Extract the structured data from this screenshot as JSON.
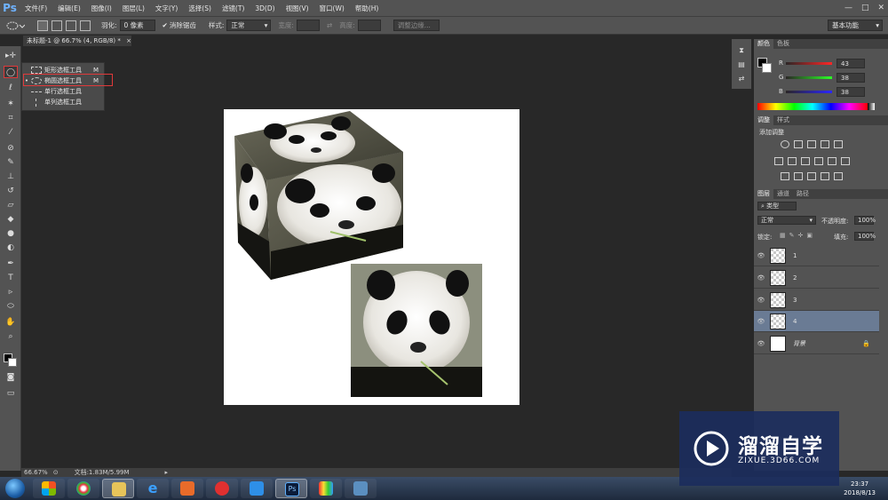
{
  "app": {
    "logo": "Ps",
    "menu": [
      "文件(F)",
      "编辑(E)",
      "图像(I)",
      "图层(L)",
      "文字(Y)",
      "选择(S)",
      "滤镜(T)",
      "3D(D)",
      "视图(V)",
      "窗口(W)",
      "帮助(H)"
    ],
    "window_controls": [
      "—",
      "□",
      "✕"
    ]
  },
  "options": {
    "feather_label": "羽化:",
    "feather_value": "0 像素",
    "antialias_label": "消除锯齿",
    "style_label": "样式:",
    "style_value": "正常",
    "width_label": "宽度:",
    "height_label": "高度:",
    "refine_edge": "调整边缘...",
    "workspace": "基本功能"
  },
  "document": {
    "tab_title": "未标题-1 @ 66.7% (4, RGB/8) *",
    "close": "×"
  },
  "flyout": {
    "items": [
      {
        "label": "矩形选框工具",
        "key": "M",
        "selected": false
      },
      {
        "label": "椭圆选框工具",
        "key": "M",
        "selected": true
      },
      {
        "label": "单行选框工具",
        "key": "",
        "selected": false
      },
      {
        "label": "单列选框工具",
        "key": "",
        "selected": false
      }
    ],
    "bullet": "•"
  },
  "color_panel": {
    "tabs": [
      "颜色",
      "色板"
    ],
    "r_label": "R",
    "r_value": "43",
    "g_label": "G",
    "g_value": "38",
    "b_label": "B",
    "b_value": "38"
  },
  "adjust_panel": {
    "tabs": [
      "调整",
      "样式"
    ],
    "title": "添加调整"
  },
  "layers_panel": {
    "tabs": [
      "图层",
      "通道",
      "路径"
    ],
    "filter_kind": "类型",
    "blend_mode": "正常",
    "opacity_label": "不透明度:",
    "opacity_value": "100%",
    "lock_label": "锁定:",
    "fill_label": "填充:",
    "fill_value": "100%",
    "layers": [
      {
        "name": "1",
        "selected": false
      },
      {
        "name": "2",
        "selected": false
      },
      {
        "name": "3",
        "selected": false
      },
      {
        "name": "4",
        "selected": true
      },
      {
        "name": "背景",
        "selected": false
      }
    ]
  },
  "status": {
    "zoom": "66.67%",
    "doc_size": "文档:1.83M/5.99M"
  },
  "taskbar": {
    "time": "23:37",
    "date": "2018/8/13"
  },
  "watermark": {
    "title": "溜溜自学",
    "url": "ZIXUE.3D66.COM"
  },
  "colors": {
    "highlight_red": "#e0393a",
    "selected_layer": "#6a7b94",
    "watermark_bg": "#1c2d5c"
  }
}
